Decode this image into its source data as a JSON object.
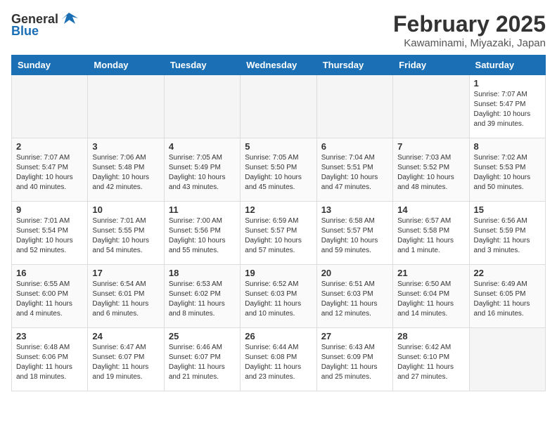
{
  "header": {
    "logo_general": "General",
    "logo_blue": "Blue",
    "title": "February 2025",
    "subtitle": "Kawaminami, Miyazaki, Japan"
  },
  "weekdays": [
    "Sunday",
    "Monday",
    "Tuesday",
    "Wednesday",
    "Thursday",
    "Friday",
    "Saturday"
  ],
  "weeks": [
    [
      {
        "day": "",
        "empty": true
      },
      {
        "day": "",
        "empty": true
      },
      {
        "day": "",
        "empty": true
      },
      {
        "day": "",
        "empty": true
      },
      {
        "day": "",
        "empty": true
      },
      {
        "day": "",
        "empty": true
      },
      {
        "day": "1",
        "sunrise": "7:07 AM",
        "sunset": "5:47 PM",
        "daylight": "10 hours and 39 minutes."
      }
    ],
    [
      {
        "day": "2",
        "sunrise": "7:07 AM",
        "sunset": "5:47 PM",
        "daylight": "10 hours and 40 minutes."
      },
      {
        "day": "3",
        "sunrise": "7:06 AM",
        "sunset": "5:48 PM",
        "daylight": "10 hours and 42 minutes."
      },
      {
        "day": "4",
        "sunrise": "7:05 AM",
        "sunset": "5:49 PM",
        "daylight": "10 hours and 43 minutes."
      },
      {
        "day": "5",
        "sunrise": "7:05 AM",
        "sunset": "5:50 PM",
        "daylight": "10 hours and 45 minutes."
      },
      {
        "day": "6",
        "sunrise": "7:04 AM",
        "sunset": "5:51 PM",
        "daylight": "10 hours and 47 minutes."
      },
      {
        "day": "7",
        "sunrise": "7:03 AM",
        "sunset": "5:52 PM",
        "daylight": "10 hours and 48 minutes."
      },
      {
        "day": "8",
        "sunrise": "7:02 AM",
        "sunset": "5:53 PM",
        "daylight": "10 hours and 50 minutes."
      }
    ],
    [
      {
        "day": "9",
        "sunrise": "7:01 AM",
        "sunset": "5:54 PM",
        "daylight": "10 hours and 52 minutes."
      },
      {
        "day": "10",
        "sunrise": "7:01 AM",
        "sunset": "5:55 PM",
        "daylight": "10 hours and 54 minutes."
      },
      {
        "day": "11",
        "sunrise": "7:00 AM",
        "sunset": "5:56 PM",
        "daylight": "10 hours and 55 minutes."
      },
      {
        "day": "12",
        "sunrise": "6:59 AM",
        "sunset": "5:57 PM",
        "daylight": "10 hours and 57 minutes."
      },
      {
        "day": "13",
        "sunrise": "6:58 AM",
        "sunset": "5:57 PM",
        "daylight": "10 hours and 59 minutes."
      },
      {
        "day": "14",
        "sunrise": "6:57 AM",
        "sunset": "5:58 PM",
        "daylight": "11 hours and 1 minute."
      },
      {
        "day": "15",
        "sunrise": "6:56 AM",
        "sunset": "5:59 PM",
        "daylight": "11 hours and 3 minutes."
      }
    ],
    [
      {
        "day": "16",
        "sunrise": "6:55 AM",
        "sunset": "6:00 PM",
        "daylight": "11 hours and 4 minutes."
      },
      {
        "day": "17",
        "sunrise": "6:54 AM",
        "sunset": "6:01 PM",
        "daylight": "11 hours and 6 minutes."
      },
      {
        "day": "18",
        "sunrise": "6:53 AM",
        "sunset": "6:02 PM",
        "daylight": "11 hours and 8 minutes."
      },
      {
        "day": "19",
        "sunrise": "6:52 AM",
        "sunset": "6:03 PM",
        "daylight": "11 hours and 10 minutes."
      },
      {
        "day": "20",
        "sunrise": "6:51 AM",
        "sunset": "6:03 PM",
        "daylight": "11 hours and 12 minutes."
      },
      {
        "day": "21",
        "sunrise": "6:50 AM",
        "sunset": "6:04 PM",
        "daylight": "11 hours and 14 minutes."
      },
      {
        "day": "22",
        "sunrise": "6:49 AM",
        "sunset": "6:05 PM",
        "daylight": "11 hours and 16 minutes."
      }
    ],
    [
      {
        "day": "23",
        "sunrise": "6:48 AM",
        "sunset": "6:06 PM",
        "daylight": "11 hours and 18 minutes."
      },
      {
        "day": "24",
        "sunrise": "6:47 AM",
        "sunset": "6:07 PM",
        "daylight": "11 hours and 19 minutes."
      },
      {
        "day": "25",
        "sunrise": "6:46 AM",
        "sunset": "6:07 PM",
        "daylight": "11 hours and 21 minutes."
      },
      {
        "day": "26",
        "sunrise": "6:44 AM",
        "sunset": "6:08 PM",
        "daylight": "11 hours and 23 minutes."
      },
      {
        "day": "27",
        "sunrise": "6:43 AM",
        "sunset": "6:09 PM",
        "daylight": "11 hours and 25 minutes."
      },
      {
        "day": "28",
        "sunrise": "6:42 AM",
        "sunset": "6:10 PM",
        "daylight": "11 hours and 27 minutes."
      },
      {
        "day": "",
        "empty": true
      }
    ]
  ]
}
